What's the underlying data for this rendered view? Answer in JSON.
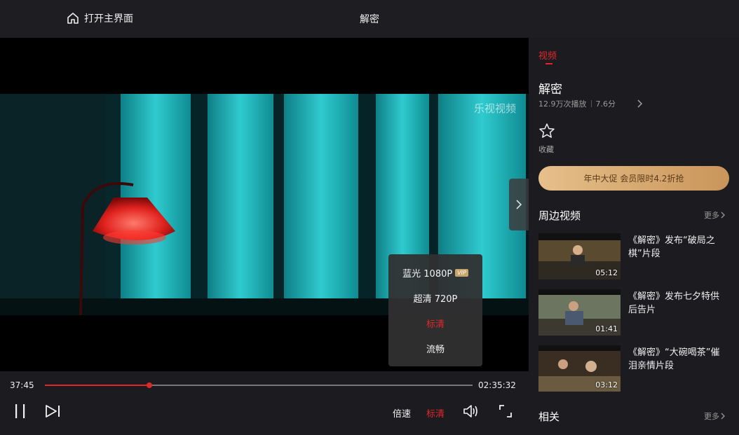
{
  "header": {
    "home_label": "打开主界面",
    "title": "解密"
  },
  "player": {
    "watermark": "乐视视频",
    "current_time": "37:45",
    "total_time": "02:35:32",
    "progress": 0.244,
    "quality_menu": [
      {
        "label": "蓝光 1080P",
        "vip": "VIP",
        "active": false
      },
      {
        "label": "超清 720P",
        "active": false
      },
      {
        "label": "标清",
        "active": true
      },
      {
        "label": "流畅",
        "active": false
      }
    ],
    "speed_label": "倍速",
    "quality_label": "标清",
    "accent": "#e0282b"
  },
  "sidebar": {
    "tab": "视频",
    "video_title": "解密",
    "plays": "12.9万次播放",
    "score": "7.6分",
    "fav_label": "收藏",
    "promo": "年中大促 会员限时4.2折抢",
    "related_videos_title": "周边视频",
    "more_label": "更多",
    "items": [
      {
        "title": "《解密》发布“破局之棋”片段",
        "duration": "05:12"
      },
      {
        "title": "《解密》发布七夕特供后告片",
        "duration": "01:41"
      },
      {
        "title": "《解密》“大碗喝茶”催泪亲情片段",
        "duration": "03:12"
      }
    ],
    "related_title": "相关"
  }
}
